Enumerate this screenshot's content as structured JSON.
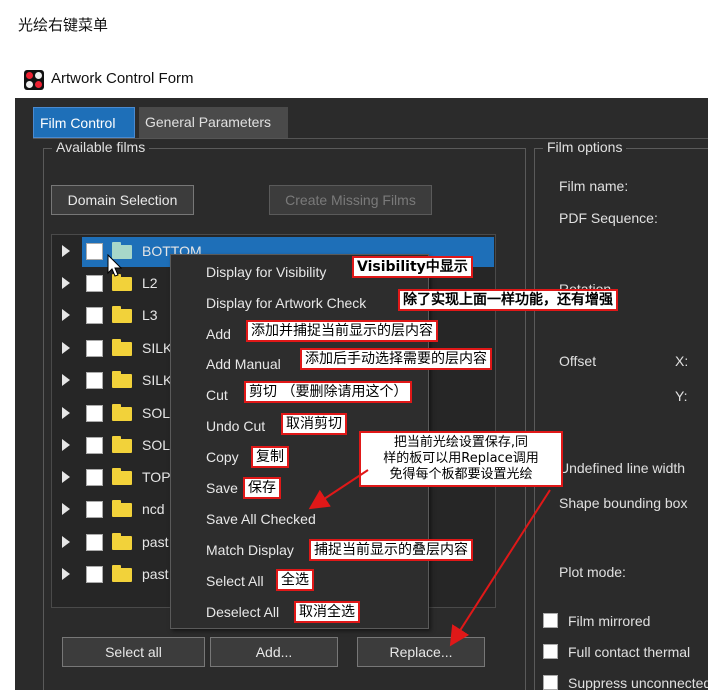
{
  "page_caption": "光绘右键菜单",
  "window": {
    "title": "Artwork Control Form",
    "icon": "artwork-app-icon"
  },
  "tabs": [
    {
      "label": "Film Control",
      "active": true
    },
    {
      "label": "General Parameters",
      "active": false
    }
  ],
  "available_films": {
    "legend": "Available films",
    "domain_button": "Domain Selection",
    "create_missing_button": "Create Missing Films",
    "films": [
      {
        "label": "BOTTOM",
        "selected": true
      },
      {
        "label": "L2"
      },
      {
        "label": "L3"
      },
      {
        "label": "SILK"
      },
      {
        "label": "SILK"
      },
      {
        "label": "SOL"
      },
      {
        "label": "SOL"
      },
      {
        "label": "TOP"
      },
      {
        "label": "ncd"
      },
      {
        "label": "past"
      },
      {
        "label": "past"
      }
    ],
    "select_all_button": "Select all",
    "add_button": "Add...",
    "replace_button": "Replace..."
  },
  "film_options": {
    "legend": "Film options",
    "film_name_label": "Film name:",
    "pdf_sequence_label": "PDF Sequence:",
    "rotation_label": "Rotation",
    "offset_label": "Offset",
    "x_label": "X:",
    "y_label": "Y:",
    "undefined_line_width_label": "Undefined line width",
    "shape_bounding_box_label": "Shape bounding box",
    "plot_mode_label": "Plot mode:",
    "film_mirrored_label": "Film mirrored",
    "full_contact_thermal_label": "Full contact thermal",
    "suppress_unconnected_label": "Suppress unconnected"
  },
  "context_menu": {
    "items": [
      {
        "label": "Display for Visibility",
        "note": "Visibility中显示"
      },
      {
        "label": "Display for Artwork Check",
        "note": "除了实现上面一样功能，还有增强"
      },
      {
        "label": "Add",
        "note": "添加并捕捉当前显示的层内容"
      },
      {
        "label": "Add Manual",
        "note": "添加后手动选择需要的层内容"
      },
      {
        "label": "Cut",
        "note": "剪切 （要删除请用这个）"
      },
      {
        "label": "Undo Cut",
        "note": "取消剪切"
      },
      {
        "label": "Copy",
        "note": "复制"
      },
      {
        "label": "Save",
        "note": "保存"
      },
      {
        "label": "Save All Checked",
        "note": ""
      },
      {
        "label": "Match Display",
        "note": "捕捉当前显示的叠层内容"
      },
      {
        "label": "Select All",
        "note": "全选"
      },
      {
        "label": "Deselect All",
        "note": "取消全选"
      }
    ]
  },
  "callout": {
    "line1": "把当前光绘设置保存,同",
    "line2": "样的板可以用Replace调用",
    "line3": "免得每个板都要设置光绘"
  },
  "colors": {
    "accent": "#1e6fb8",
    "annotation_border": "#e01818",
    "background": "#2b2b2b"
  }
}
